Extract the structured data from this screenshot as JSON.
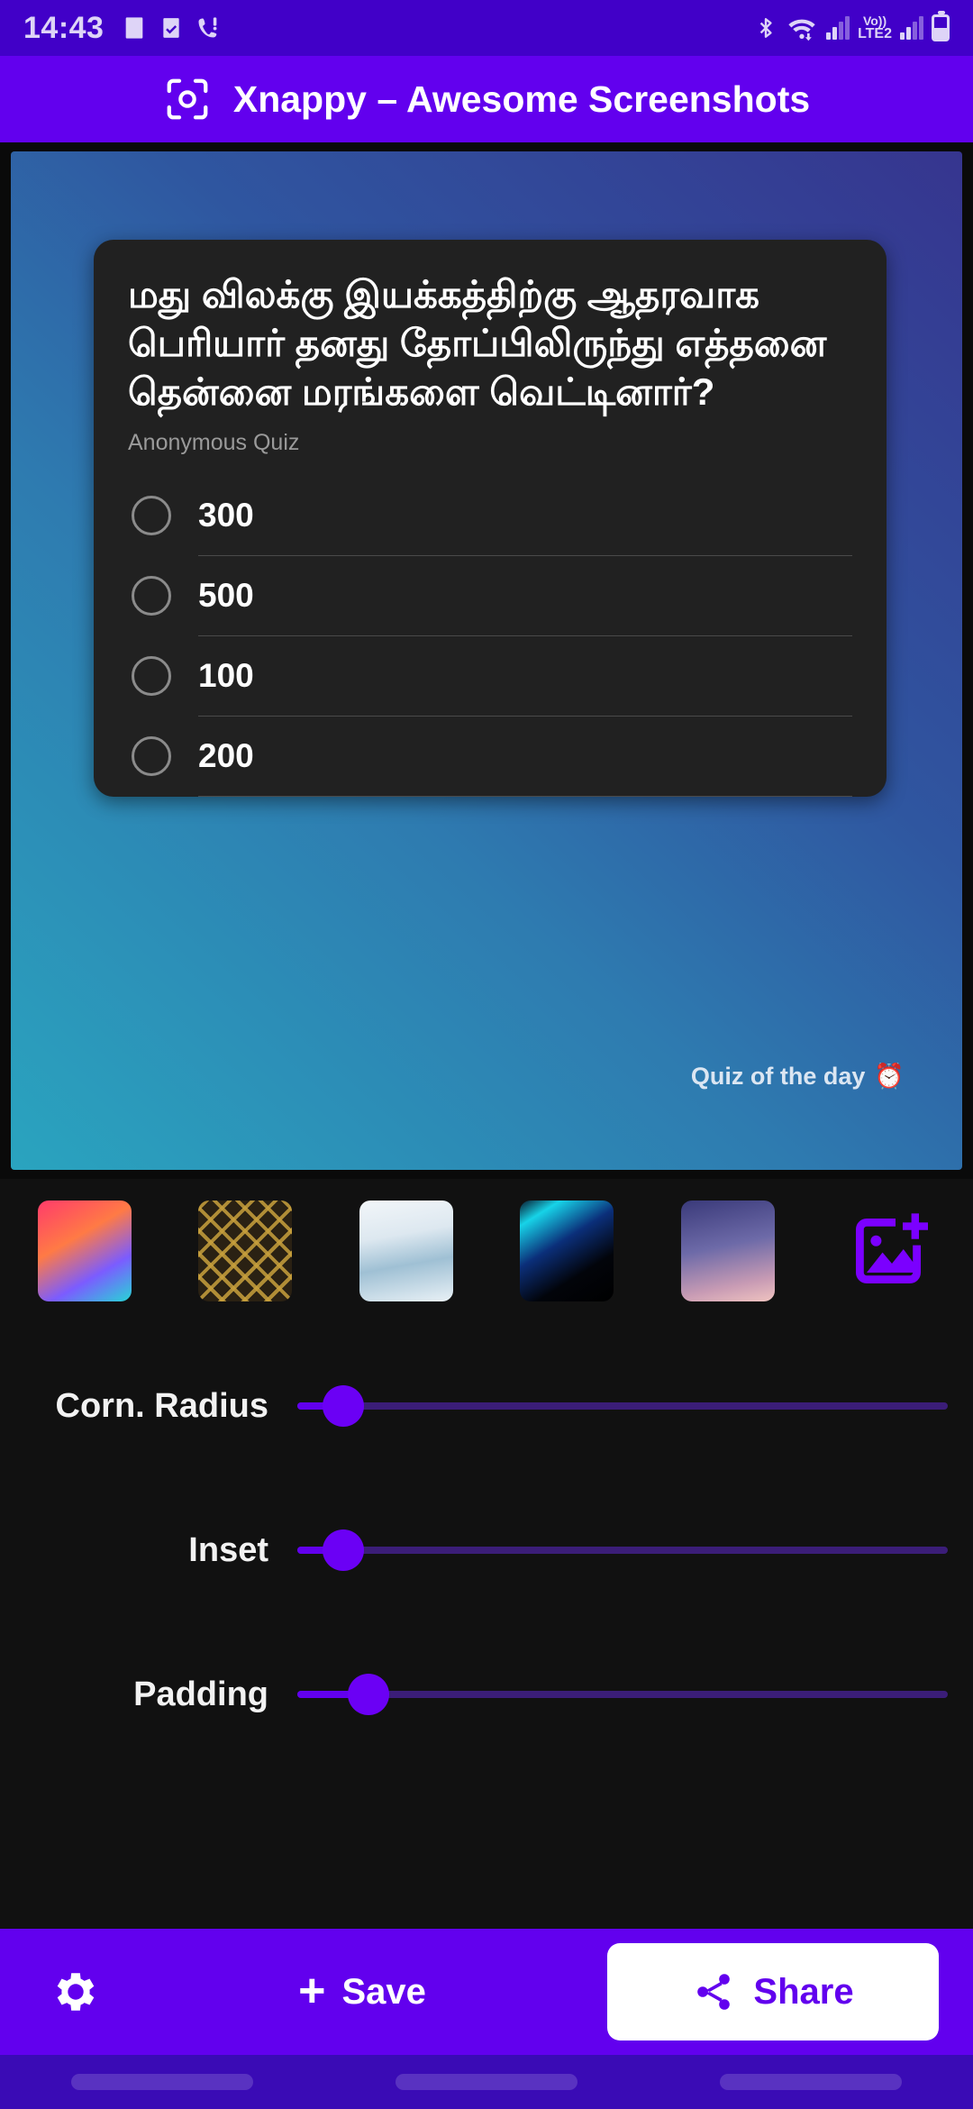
{
  "statusbar": {
    "clock": "14:43",
    "left_icons": [
      "image-icon",
      "checkbox-icon",
      "missed-call-icon"
    ],
    "right_icons": [
      "bluetooth-icon",
      "wifi-icon",
      "signal-bars-icon",
      "volte-icon",
      "signal-bars-2-icon",
      "battery-icon"
    ],
    "volte_line1": "Vo))",
    "volte_line2": "LTE2"
  },
  "appbar": {
    "icon": "scan-camera-icon",
    "title": "Xnappy – Awesome Screenshots"
  },
  "preview": {
    "background_gradient": [
      "#2aa4bf",
      "#2e7bb0",
      "#2f56a0",
      "#36358f"
    ],
    "card": {
      "question": "மது விலக்கு இயக்கத்திற்கு ஆதரவாக பெரியார் தனது தோப்பிலிருந்து எத்தனை தென்னை மரங்களை வெட்டினார்?",
      "subtitle": "Anonymous Quiz",
      "options": [
        {
          "label": "300",
          "selected": false
        },
        {
          "label": "500",
          "selected": false
        },
        {
          "label": "100",
          "selected": false
        },
        {
          "label": "200",
          "selected": false
        }
      ]
    },
    "caption": "Quiz of the day",
    "caption_emoji": "⏰"
  },
  "thumbnails": {
    "items": [
      {
        "name": "thumb-gradient-sunset",
        "class": "t1"
      },
      {
        "name": "thumb-gold-pattern",
        "class": "t2"
      },
      {
        "name": "thumb-sky-photo",
        "class": "t3"
      },
      {
        "name": "thumb-dark-blue",
        "class": "t4"
      },
      {
        "name": "thumb-purple-pink",
        "class": "t5"
      }
    ],
    "add_icon": "add-image-icon"
  },
  "sliders": [
    {
      "label": "Corn. Radius",
      "value_pct": 7
    },
    {
      "label": "Inset",
      "value_pct": 7
    },
    {
      "label": "Padding",
      "value_pct": 11
    }
  ],
  "actionbar": {
    "settings_icon": "gear-icon",
    "save_label": "Save",
    "save_icon": "plus-icon",
    "share_label": "Share",
    "share_icon": "share-icon"
  },
  "colors": {
    "accent": "#6200ee",
    "statusbar": "#4100c8",
    "navbar": "#3a0bb5",
    "card": "#212121"
  }
}
